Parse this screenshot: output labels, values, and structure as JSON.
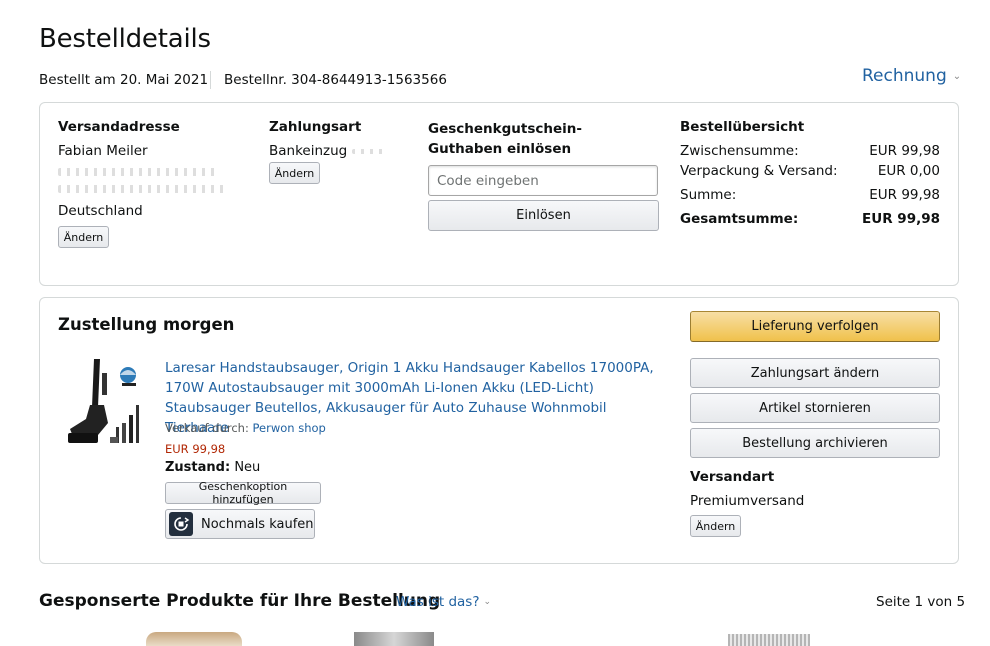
{
  "page": {
    "title": "Bestelldetails",
    "ordered_on": "Bestellt am 20. Mai 2021",
    "order_number": "Bestellnr. 304-8644913-1563566",
    "invoice_link": "Rechnung"
  },
  "summary_box": {
    "shipping": {
      "heading": "Versandadresse",
      "name": "Fabian Meiler",
      "country": "Deutschland",
      "change": "Ändern"
    },
    "payment": {
      "heading": "Zahlungsart",
      "method": "Bankeinzug",
      "change": "Ändern"
    },
    "gift": {
      "heading": "Geschenkgutschein-Guthaben einlösen",
      "placeholder": "Code eingeben",
      "redeem": "Einlösen"
    },
    "overview": {
      "heading": "Bestellübersicht",
      "rows": [
        {
          "label": "Zwischensumme:",
          "value": "EUR 99,98"
        },
        {
          "label": "Verpackung & Versand:",
          "value": "EUR 0,00"
        },
        {
          "label": "Summe:",
          "value": "EUR 99,98"
        },
        {
          "label": "Gesamtsumme:",
          "value": "EUR 99,98"
        }
      ]
    }
  },
  "delivery": {
    "heading": "Zustellung morgen",
    "product": {
      "title": "Laresar Handstaubsauger, Origin 1 Akku Handsauger Kabellos 17000PA, 170W Autostaubsauger mit 3000mAh Li-Ionen Akku (LED-Licht) Staubsauger Beutellos, Akkusauger für Auto Zuhause Wohnmobil Tierhaare",
      "sold_by_label": "Verkauf durch:",
      "seller": "Perwon shop",
      "price": "EUR 99,98",
      "condition_label": "Zustand:",
      "condition": "Neu",
      "gift_option": "Geschenkoption hinzufügen",
      "buy_again": "Nochmals kaufen"
    },
    "actions": {
      "track": "Lieferung verfolgen",
      "change_payment": "Zahlungsart ändern",
      "cancel": "Artikel stornieren",
      "archive": "Bestellung archivieren"
    },
    "shipping_type": {
      "heading": "Versandart",
      "value": "Premiumversand",
      "change": "Ändern"
    }
  },
  "sponsored": {
    "heading": "Gesponserte Produkte für Ihre Bestellung",
    "what_is_this": "Was ist das?",
    "pagination": "Seite 1 von 5"
  },
  "colors": {
    "link": "#2162a1",
    "price": "#b12704",
    "primary_button": "#f0c14b",
    "border": "#d5d9d9"
  }
}
